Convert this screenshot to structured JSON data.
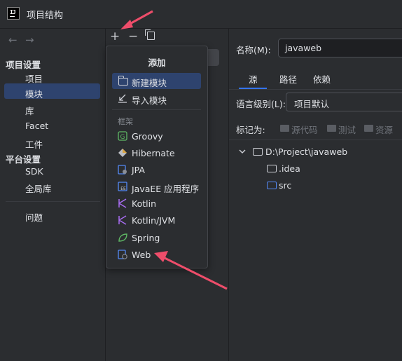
{
  "window": {
    "title": "项目结构",
    "logo_text": "IJ"
  },
  "nav": {
    "back_icon": "←",
    "forward_icon": "→",
    "project_settings_heading": "项目设置",
    "project_items": [
      "项目",
      "模块",
      "库",
      "Facet",
      "工件"
    ],
    "platform_settings_heading": "平台设置",
    "platform_items": [
      "SDK",
      "全局库"
    ],
    "problems": "问题",
    "selected": "模块"
  },
  "toolbar": {
    "add": "+",
    "remove": "−"
  },
  "popup": {
    "title": "添加",
    "new_module": "新建模块",
    "import_module": "导入模块",
    "section": "框架",
    "frameworks": [
      "Groovy",
      "Hibernate",
      "JPA",
      "JavaEE 应用程序",
      "Kotlin",
      "Kotlin/JVM",
      "Spring",
      "Web"
    ],
    "icon_names": [
      "groovy-icon",
      "hibernate-icon",
      "jpa-icon",
      "javaee-icon",
      "kotlin-icon",
      "kotlin-jvm-icon",
      "spring-icon",
      "web-icon"
    ]
  },
  "module": {
    "name_label": "名称(M):",
    "name_value": "javaweb",
    "tabs": [
      "源",
      "路径",
      "依赖"
    ],
    "active_tab": "源",
    "language_level_label": "语言级别(L):",
    "language_level_value": "项目默认",
    "mark_as_label": "标记为:",
    "mark_as_buttons": [
      "源代码",
      "测试",
      "资源"
    ],
    "tree_root": "D:\\Project\\javaweb",
    "tree_children": [
      ".idea",
      "src"
    ]
  },
  "colors": {
    "accent": "#3574f0",
    "selection": "#2e436e",
    "annotation_arrow": "#ee4d6a"
  }
}
